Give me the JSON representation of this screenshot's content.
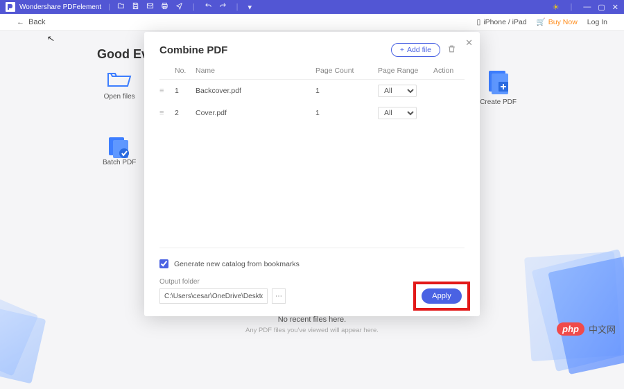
{
  "app_title": "Wondershare PDFelement",
  "back": "Back",
  "topbar": {
    "ios": "iPhone / iPad",
    "buy": "Buy Now",
    "login": "Log In"
  },
  "greeting": "Good Evening",
  "home": {
    "open": "Open files",
    "batch": "Batch PDF",
    "create": "Create PDF"
  },
  "footer": {
    "main": "No recent files here.",
    "sub": "Any PDF files you've viewed will appear here."
  },
  "modal": {
    "title": "Combine PDF",
    "add_file": "Add file",
    "cols": {
      "no": "No.",
      "name": "Name",
      "pages": "Page Count",
      "range": "Page Range",
      "action": "Action"
    },
    "rows": [
      {
        "no": "1",
        "name": "Backcover.pdf",
        "pages": "1",
        "range": "All"
      },
      {
        "no": "2",
        "name": "Cover.pdf",
        "pages": "1",
        "range": "All"
      }
    ],
    "catalog": "Generate new catalog from bookmarks",
    "output_label": "Output folder",
    "output_path": "C:\\Users\\cesar\\OneDrive\\Desktop\\PDFelem",
    "apply": "Apply"
  },
  "phpbadge": {
    "pill": "php",
    "text": "中文网"
  }
}
